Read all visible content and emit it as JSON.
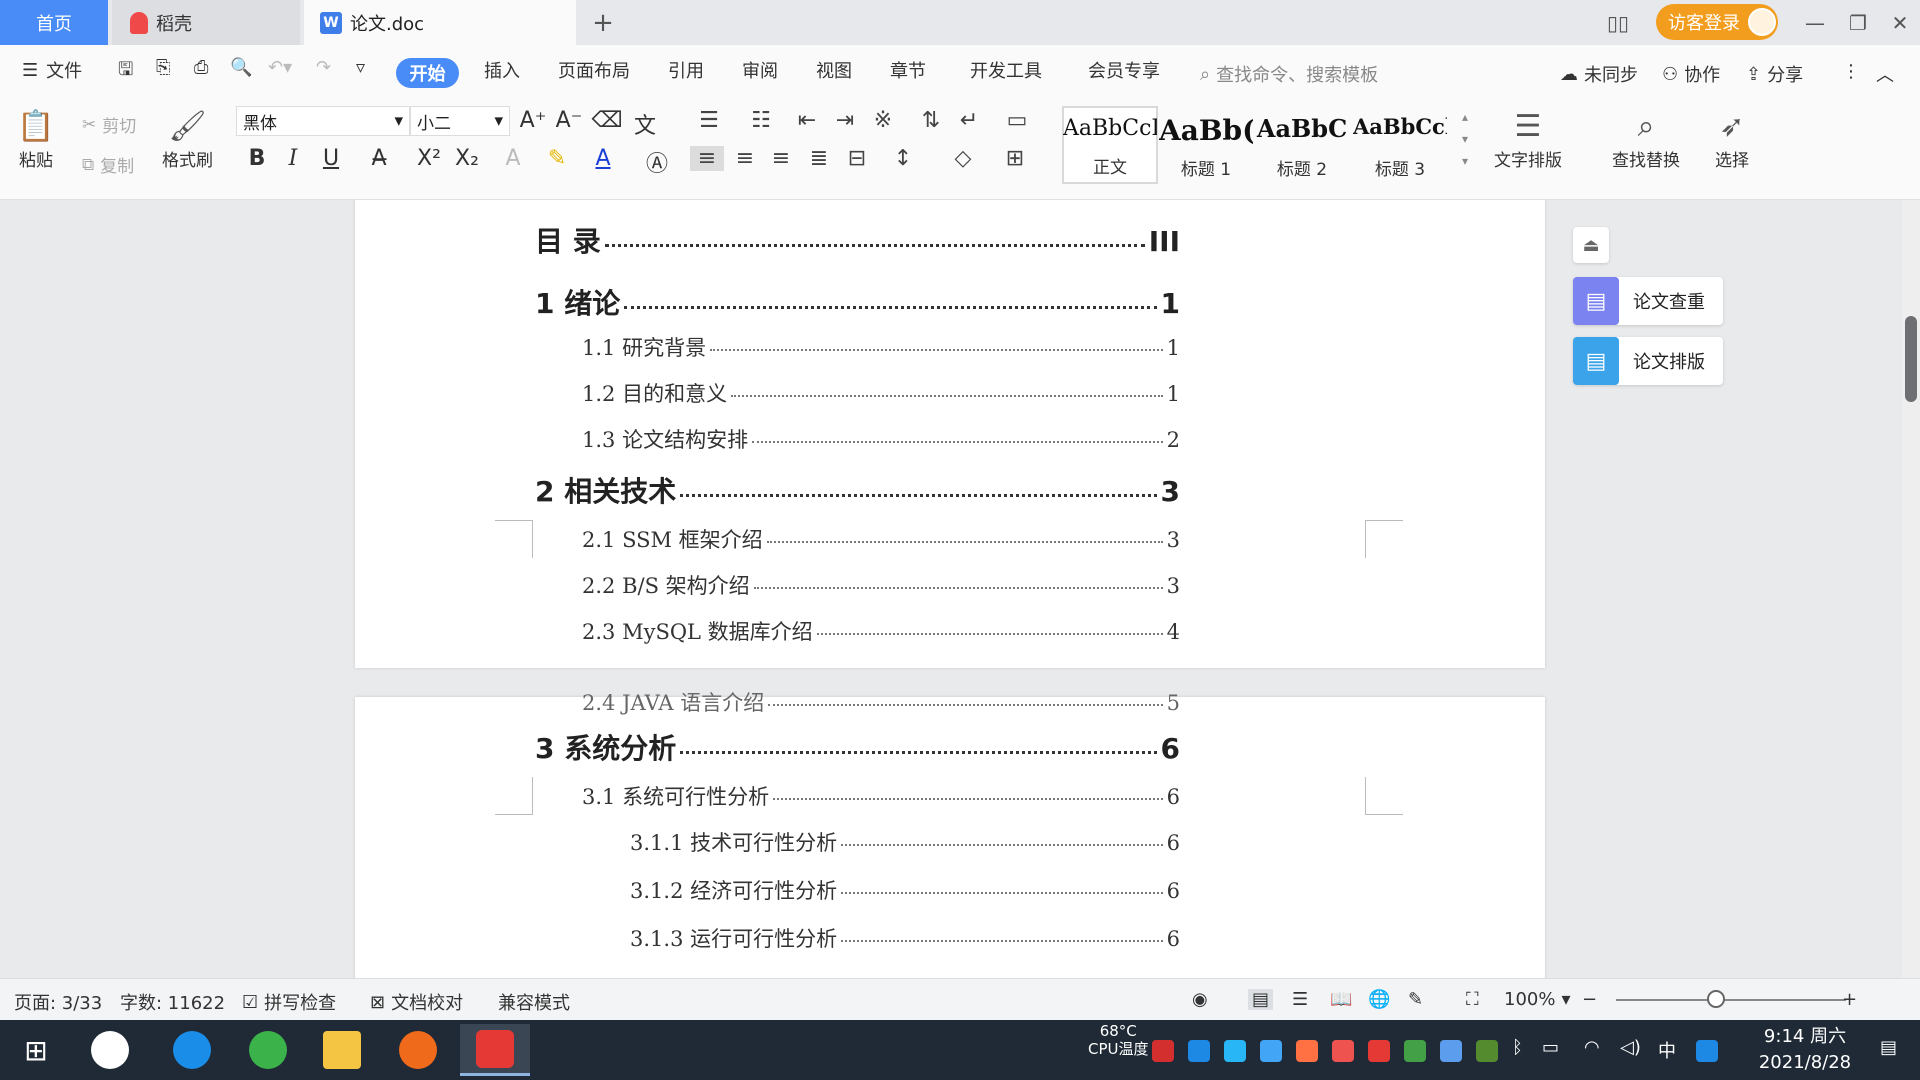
{
  "tabs": {
    "home": "首页",
    "docer": "稻壳",
    "doc": "论文.doc"
  },
  "titlebar": {
    "login": "访客登录"
  },
  "menu": {
    "file": "文件",
    "items": [
      "开始",
      "插入",
      "页面布局",
      "引用",
      "审阅",
      "视图",
      "章节",
      "开发工具",
      "会员专享"
    ],
    "search_placeholder": "查找命令、搜索模板",
    "sync": "未同步",
    "collab": "协作",
    "share": "分享"
  },
  "ribbon": {
    "paste": "粘贴",
    "cut": "剪切",
    "copy": "复制",
    "format_painter": "格式刷",
    "font_name": "黑体",
    "font_size": "小二",
    "styles": [
      {
        "preview": "AaBbCcI",
        "label": "正文"
      },
      {
        "preview": "AaBb(",
        "label": "标题 1"
      },
      {
        "preview": "AaBbC",
        "label": "标题 2"
      },
      {
        "preview": "AaBbCcl",
        "label": "标题 3"
      }
    ],
    "text_layout": "文字排版",
    "find_replace": "查找替换",
    "select": "选择"
  },
  "toc": {
    "page1": [
      {
        "level": 1,
        "text": "目  录",
        "page": "III"
      },
      {
        "level": 1,
        "text": "1  绪论",
        "page": "1"
      },
      {
        "level": 2,
        "text": "1.1  研究背景",
        "page": "1"
      },
      {
        "level": 2,
        "text": "1.2  目的和意义",
        "page": "1"
      },
      {
        "level": 2,
        "text": "1.3  论文结构安排",
        "page": "2"
      },
      {
        "level": 1,
        "text": "2  相关技术",
        "page": "3"
      },
      {
        "level": 2,
        "text": "2.1 SSM 框架介绍",
        "page": "3"
      },
      {
        "level": 2,
        "text": "2.2 B/S 架构介绍",
        "page": "3"
      },
      {
        "level": 2,
        "text": "2.3 MySQL 数据库介绍",
        "page": "4"
      },
      {
        "level": 2,
        "text": "2.4 JAVA 语言介绍",
        "page": "5"
      }
    ],
    "page2": [
      {
        "level": 1,
        "text": "3  系统分析",
        "page": "6"
      },
      {
        "level": 2,
        "text": "3.1  系统可行性分析",
        "page": "6"
      },
      {
        "level": 3,
        "text": "3.1.1  技术可行性分析",
        "page": "6"
      },
      {
        "level": 3,
        "text": "3.1.2  经济可行性分析",
        "page": "6"
      },
      {
        "level": 3,
        "text": "3.1.3  运行可行性分析",
        "page": "6"
      }
    ]
  },
  "side_panel": {
    "check": "论文查重",
    "layout": "论文排版"
  },
  "status": {
    "page": "页面: 3/33",
    "words": "字数: 11622",
    "spell": "拼写检查",
    "proof": "文档校对",
    "compat": "兼容模式",
    "zoom": "100%"
  },
  "taskbar": {
    "temp": "68°C",
    "cpu": "CPU温度",
    "ime": "中",
    "time": "9:14 周六",
    "date": "2021/8/28"
  },
  "colors": {
    "accent": "#4a8cf7",
    "login": "#f39d1f",
    "taskbar": "#1f2a36"
  }
}
